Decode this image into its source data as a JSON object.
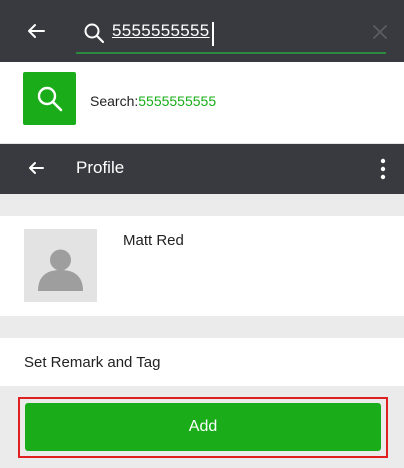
{
  "search": {
    "query": "5555555555"
  },
  "suggestion": {
    "prefix": "Search:",
    "value": "5555555555"
  },
  "profile_bar": {
    "title": "Profile"
  },
  "contact": {
    "name": "Matt Red"
  },
  "remark": {
    "label": "Set Remark and Tag"
  },
  "actions": {
    "add_label": "Add"
  },
  "colors": {
    "bar": "#393a3f",
    "accent": "#1aad19",
    "highlight": "#e02020",
    "section_bg": "#ebebeb"
  }
}
